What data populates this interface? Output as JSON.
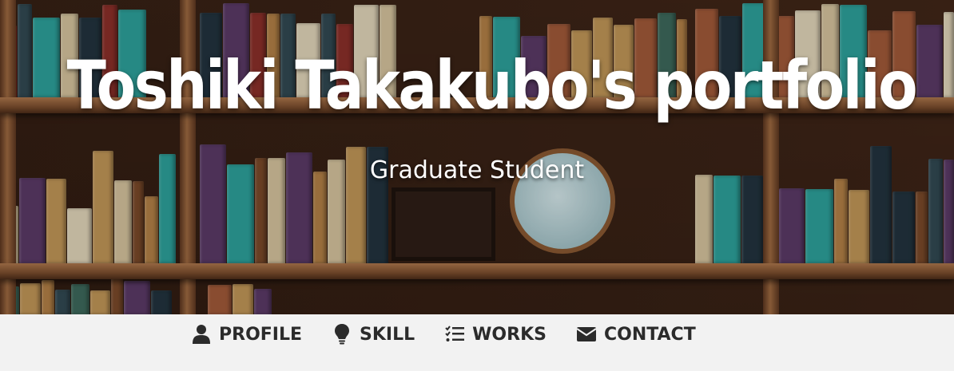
{
  "hero": {
    "title": "Toshiki Takakubo's portfolio",
    "subtitle": "Graduate Student",
    "background": "bookshelf-photo"
  },
  "nav": {
    "items": [
      {
        "label": "PROFILE",
        "icon": "user-icon"
      },
      {
        "label": "SKILL",
        "icon": "lightbulb-icon"
      },
      {
        "label": "WORKS",
        "icon": "checklist-icon"
      },
      {
        "label": "CONTACT",
        "icon": "envelope-icon"
      }
    ]
  },
  "colors": {
    "nav_background": "#f2f2f2",
    "nav_text": "#2b2b2b",
    "hero_text": "#ffffff"
  }
}
